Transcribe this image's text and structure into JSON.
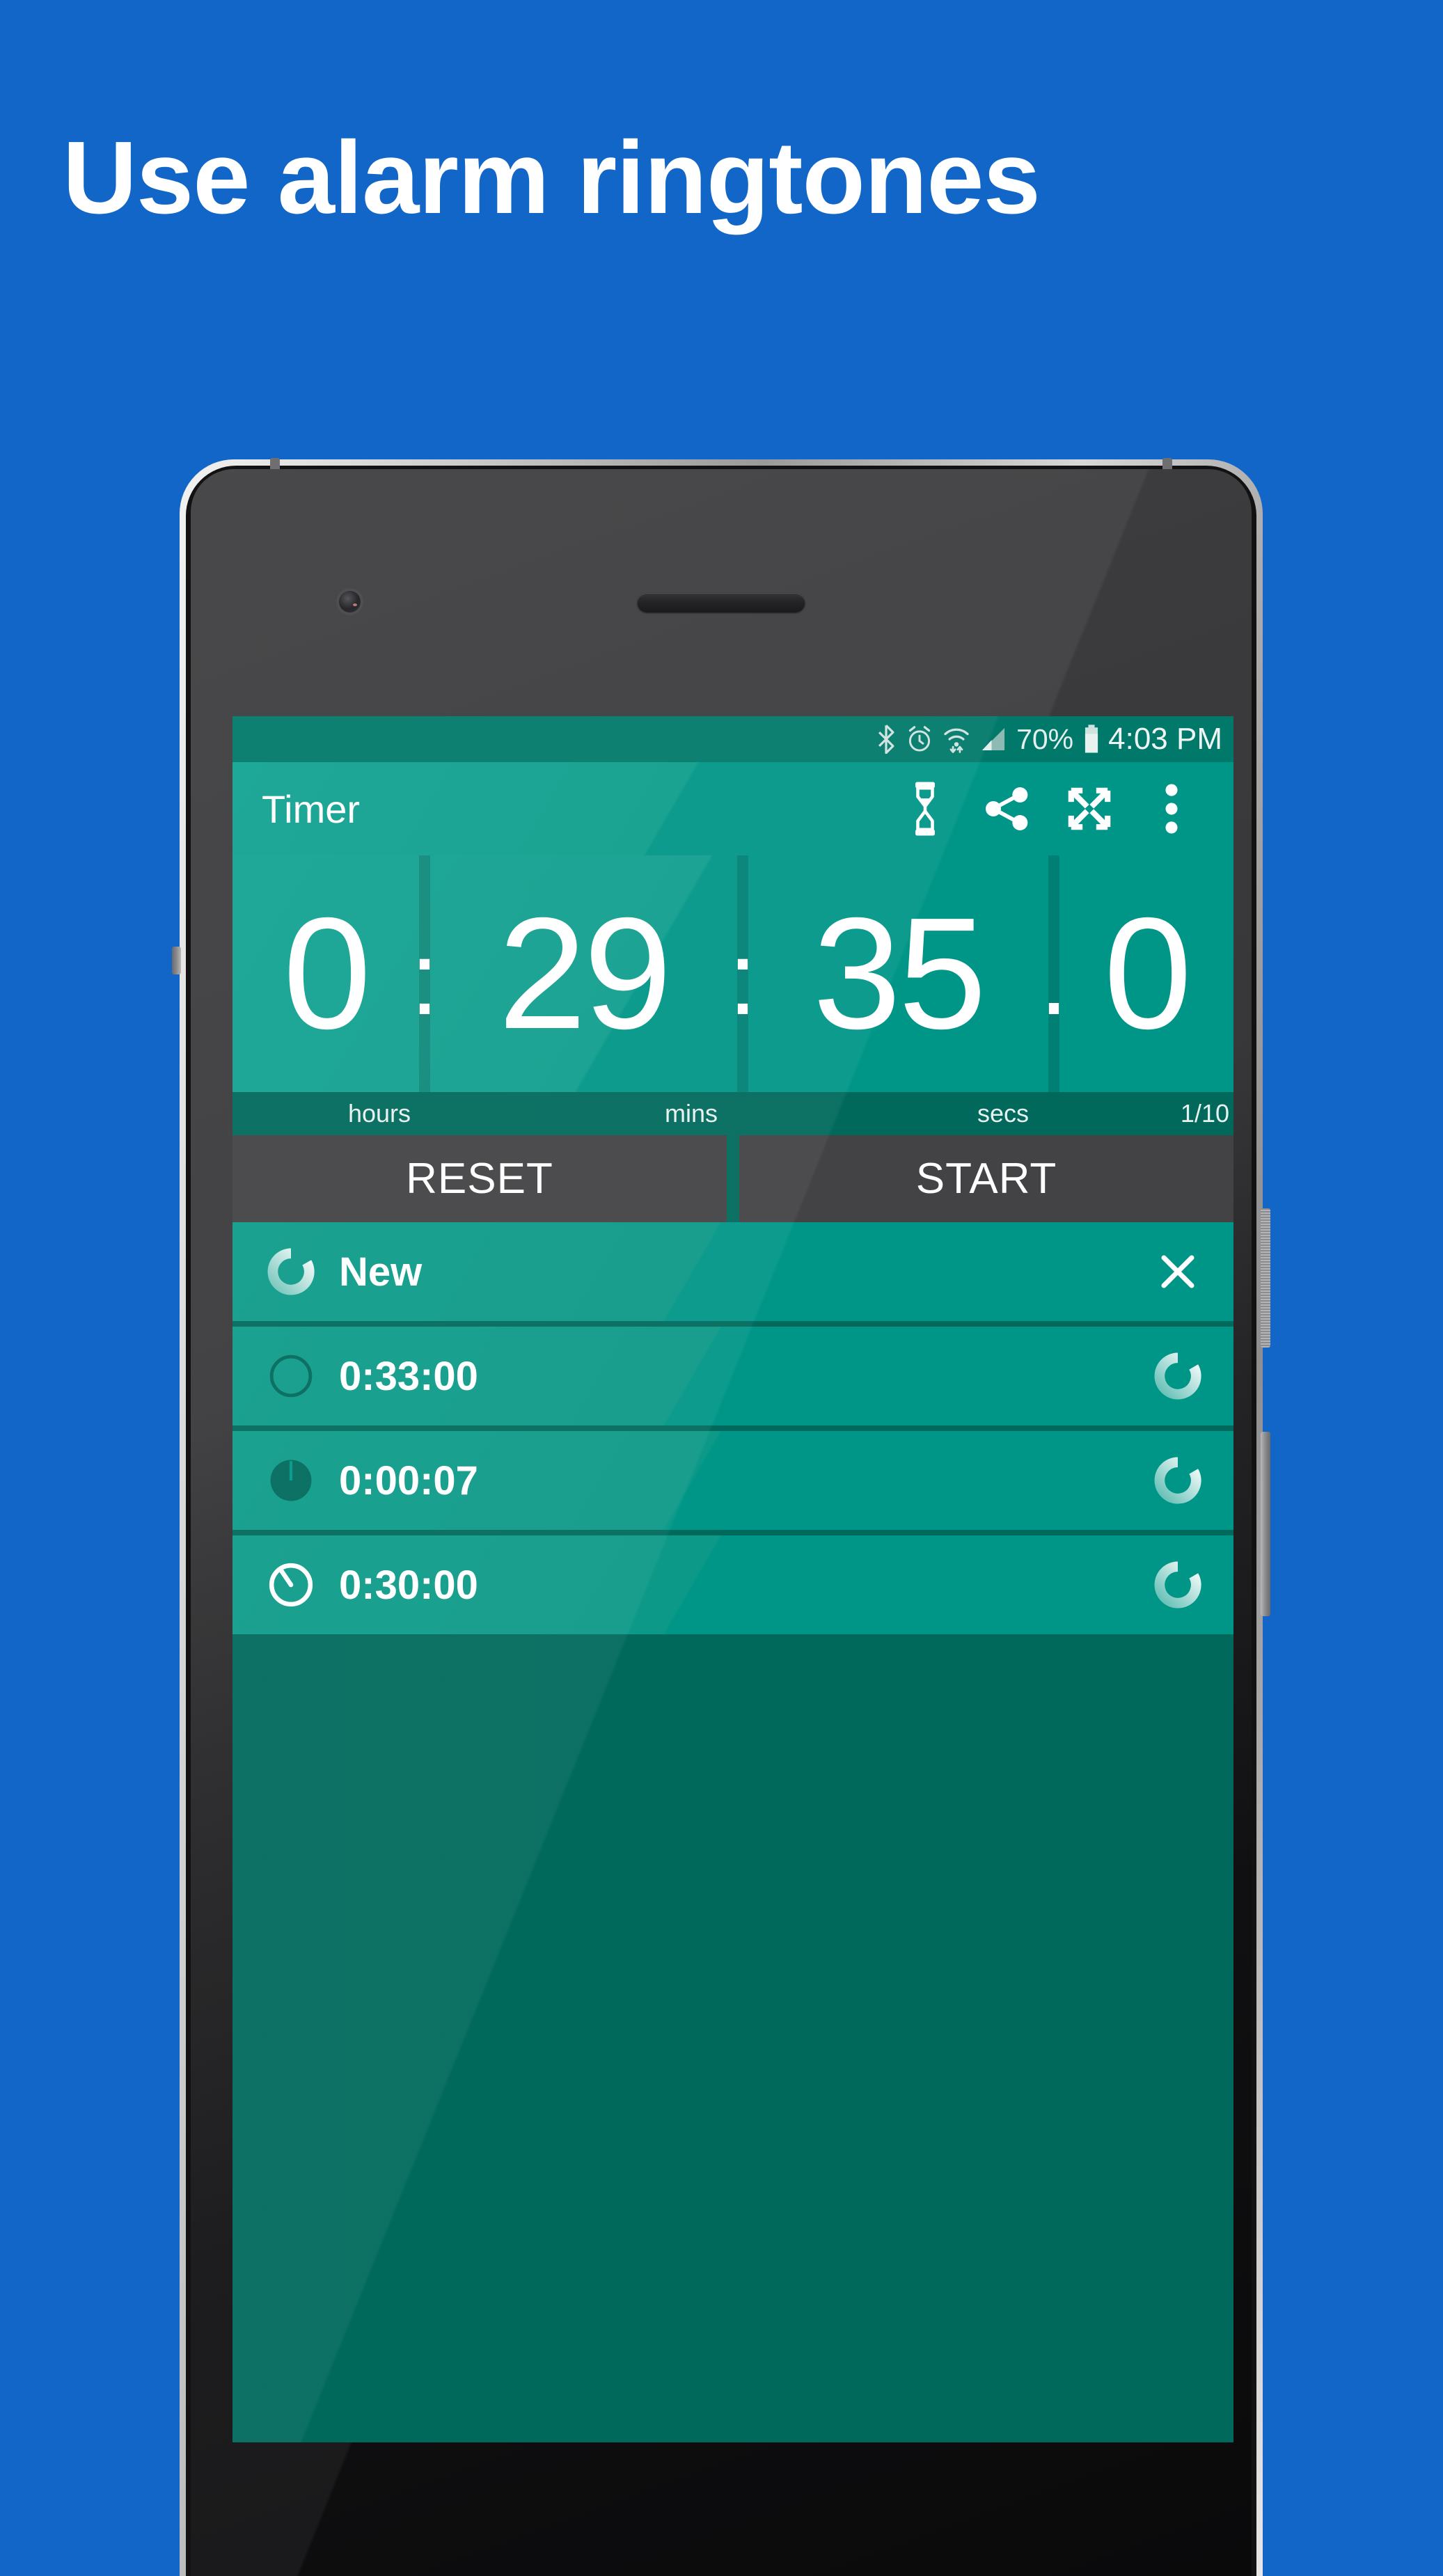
{
  "promo": {
    "headline": "Use alarm ringtones",
    "background_color": "#1266c8"
  },
  "theme": {
    "primary": "#009687",
    "primary_dark": "#00695c",
    "status_bar": "#00796b",
    "button_gray": "#434345",
    "text_on_primary": "#ffffff"
  },
  "status_bar": {
    "icons": [
      "bluetooth-icon",
      "alarm-icon",
      "wifi-icon",
      "cell-signal-icon",
      "battery-icon"
    ],
    "battery_percent": "70%",
    "time": "4:03 PM"
  },
  "app_bar": {
    "title": "Timer",
    "actions": [
      {
        "name": "hourglass-icon",
        "label": "Hourglass"
      },
      {
        "name": "share-icon",
        "label": "Share"
      },
      {
        "name": "fullscreen-icon",
        "label": "Fullscreen"
      },
      {
        "name": "overflow-menu-icon",
        "label": "More options"
      }
    ]
  },
  "timer": {
    "hours": "0",
    "minutes": "29",
    "seconds": "35",
    "tenths": "0",
    "separator_major": ":",
    "separator_minor": ".",
    "full_value": "0:29:35.0",
    "labels": {
      "hours": "hours",
      "minutes": "mins",
      "seconds": "secs",
      "tenths": "1/10"
    }
  },
  "controls": {
    "reset_label": "RESET",
    "start_label": "START"
  },
  "timer_list": [
    {
      "label": "New",
      "left_icon": "progress-ring-icon",
      "right_icon": "close-icon",
      "right_icon_kind": "close"
    },
    {
      "label": "0:33:00",
      "left_icon": "circle-outline-icon",
      "right_icon": "progress-ring-icon",
      "right_icon_kind": "ring"
    },
    {
      "label": "0:00:07",
      "left_icon": "circle-filled-icon",
      "right_icon": "progress-ring-icon",
      "right_icon_kind": "ring"
    },
    {
      "label": "0:30:00",
      "left_icon": "timer-ring-icon",
      "right_icon": "progress-ring-icon",
      "right_icon_kind": "ring"
    }
  ]
}
